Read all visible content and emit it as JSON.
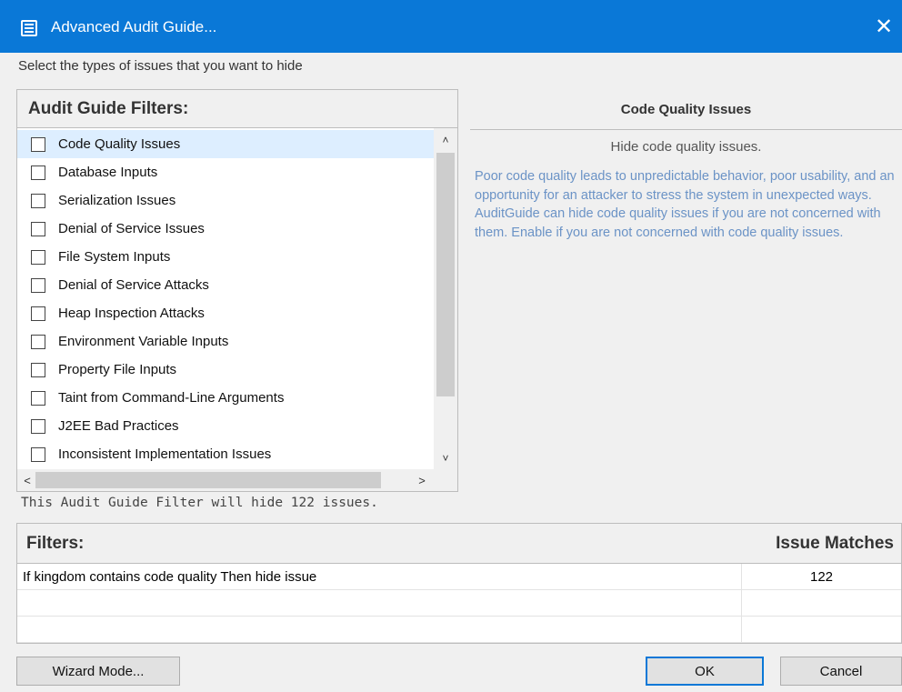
{
  "window": {
    "title": "Advanced Audit Guide...",
    "close_glyph": "✕",
    "accent_color": "#0a78d7"
  },
  "instruction": "Select the types of issues that you want to hide",
  "filters_panel": {
    "header": "Audit Guide Filters:",
    "items": [
      {
        "label": "Code Quality Issues",
        "checked": false,
        "selected": true
      },
      {
        "label": "Database Inputs",
        "checked": false
      },
      {
        "label": "Serialization Issues",
        "checked": false
      },
      {
        "label": "Denial of Service Issues",
        "checked": false
      },
      {
        "label": "File System Inputs",
        "checked": false
      },
      {
        "label": "Denial of Service Attacks",
        "checked": false
      },
      {
        "label": "Heap Inspection Attacks",
        "checked": false
      },
      {
        "label": "Environment Variable Inputs",
        "checked": false
      },
      {
        "label": "Property File Inputs",
        "checked": false
      },
      {
        "label": "Taint from Command-Line Arguments",
        "checked": false
      },
      {
        "label": "J2EE Bad Practices",
        "checked": false
      },
      {
        "label": "Inconsistent Implementation Issues",
        "checked": false
      }
    ],
    "scroll_up_glyph": "˄",
    "scroll_down_glyph": "˅",
    "scroll_left_glyph": "<",
    "scroll_right_glyph": ">"
  },
  "hide_count_text": "This Audit Guide Filter will hide 122 issues.",
  "detail": {
    "title": "Code Quality Issues",
    "subtitle": "Hide code quality issues.",
    "description": "Poor code quality leads to unpredictable behavior, poor usability, and an opportunity for an attacker to stress the system in unexpected ways. AuditGuide can hide code quality issues if you are not concerned with them. Enable if you are not concerned with code quality issues.",
    "description_color": "#6b93c6"
  },
  "filters_table": {
    "header_filters": "Filters:",
    "header_matches": "Issue Matches",
    "rows": [
      {
        "filter": "If kingdom contains code quality Then hide issue",
        "matches": "122"
      },
      {
        "filter": "",
        "matches": ""
      },
      {
        "filter": "",
        "matches": ""
      }
    ]
  },
  "buttons": {
    "wizard": "Wizard Mode...",
    "ok": "OK",
    "cancel": "Cancel"
  }
}
